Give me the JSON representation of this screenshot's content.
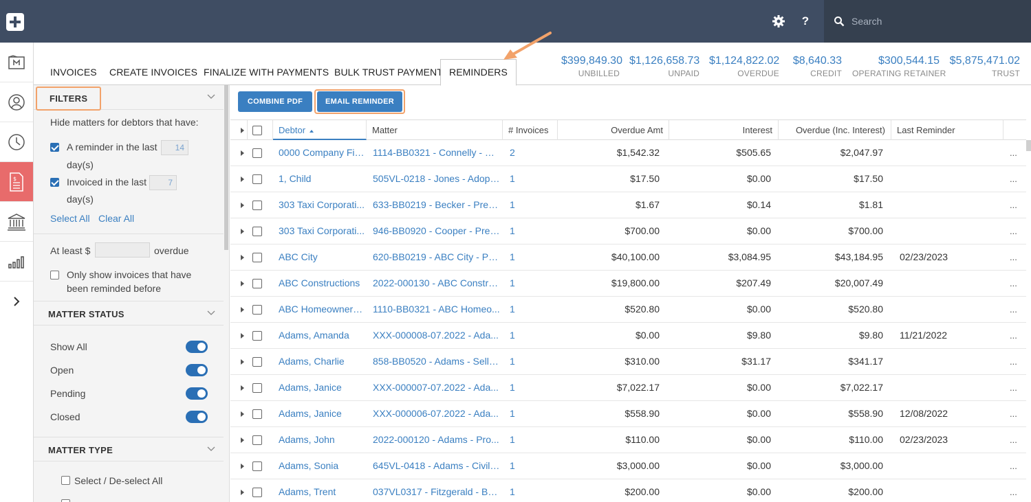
{
  "header": {
    "search_placeholder": "Search",
    "help_label": "?",
    "icons": [
      "add-icon",
      "gear-icon",
      "help-icon",
      "search-icon"
    ]
  },
  "rail": {
    "items": [
      "matters-icon",
      "contacts-icon",
      "time-icon",
      "billing-icon",
      "bank-icon",
      "reports-icon",
      "expand-icon"
    ],
    "active": "billing-icon"
  },
  "tabs": [
    "INVOICES",
    "CREATE INVOICES",
    "FINALIZE WITH PAYMENTS",
    "BULK TRUST PAYMENT",
    "REMINDERS"
  ],
  "active_tab": "REMINDERS",
  "stats": [
    {
      "value": "$399,849.30",
      "label": "UNBILLED"
    },
    {
      "value": "$1,126,658.73",
      "label": "UNPAID"
    },
    {
      "value": "$1,124,822.02",
      "label": "OVERDUE"
    },
    {
      "value": "$8,640.33",
      "label": "CREDIT"
    },
    {
      "value": "$300,544.15",
      "label": "OPERATING RETAINER"
    },
    {
      "value": "$5,875,471.02",
      "label": "TRUST"
    }
  ],
  "filters": {
    "title": "FILTERS",
    "hide_heading": "Hide matters for debtors that have:",
    "reminder_label": "A reminder in the last",
    "reminder_days": "14",
    "reminder_unit": "day(s)",
    "invoiced_label": "Invoiced in the last",
    "invoiced_days": "7",
    "invoiced_unit": "day(s)",
    "select_all": "Select All",
    "clear_all": "Clear All",
    "at_least_label": "At least $",
    "at_least_value": "",
    "overdue_label": "overdue",
    "only_show_line1": "Only show invoices that have",
    "only_show_line2": "been reminded before",
    "matter_status_title": "MATTER STATUS",
    "statuses": [
      "Show All",
      "Open",
      "Pending",
      "Closed"
    ],
    "matter_type_title": "MATTER TYPE",
    "select_deselect_all": "Select / De-select All"
  },
  "toolbar": {
    "combine_pdf": "COMBINE PDF",
    "email_reminder": "EMAIL REMINDER"
  },
  "table": {
    "columns": [
      "Debtor",
      "Matter",
      "# Invoices",
      "Overdue Amt",
      "Interest",
      "Overdue (Inc. Interest)",
      "Last Reminder"
    ],
    "sorted_column": "Debtor",
    "rows": [
      {
        "debtor": "0000 Company Fir...",
        "matter": "1114-BB0321 - Connelly - W...",
        "invoices": "2",
        "overdue": "$1,542.32",
        "interest": "$505.65",
        "total": "$2,047.97",
        "last": ""
      },
      {
        "debtor": "1, Child",
        "matter": "505VL-0218 - Jones - Adopti...",
        "invoices": "1",
        "overdue": "$17.50",
        "interest": "$0.00",
        "total": "$17.50",
        "last": ""
      },
      {
        "debtor": "303 Taxi Corporati...",
        "matter": "633-BB0219 - Becker - Pre D...",
        "invoices": "1",
        "overdue": "$1.67",
        "interest": "$0.14",
        "total": "$1.81",
        "last": ""
      },
      {
        "debtor": "303 Taxi Corporati...",
        "matter": "946-BB0920 - Cooper - Pre ...",
        "invoices": "1",
        "overdue": "$700.00",
        "interest": "$0.00",
        "total": "$700.00",
        "last": ""
      },
      {
        "debtor": "ABC City",
        "matter": "620-BB0219 - ABC City - Pro...",
        "invoices": "1",
        "overdue": "$40,100.00",
        "interest": "$3,084.95",
        "total": "$43,184.95",
        "last": "02/23/2023"
      },
      {
        "debtor": "ABC Constructions",
        "matter": "2022-000130 - ABC Constru...",
        "invoices": "1",
        "overdue": "$19,800.00",
        "interest": "$207.49",
        "total": "$20,007.49",
        "last": ""
      },
      {
        "debtor": "ABC Homeowners...",
        "matter": "1110-BB0321 - ABC Homeo...",
        "invoices": "1",
        "overdue": "$520.80",
        "interest": "$0.00",
        "total": "$520.80",
        "last": ""
      },
      {
        "debtor": "Adams, Amanda",
        "matter": "XXX-000008-07.2022 - Ada...",
        "invoices": "1",
        "overdue": "$0.00",
        "interest": "$9.80",
        "total": "$9.80",
        "last": "11/21/2022"
      },
      {
        "debtor": "Adams, Charlie",
        "matter": "858-BB0520 - Adams - Sell -...",
        "invoices": "1",
        "overdue": "$310.00",
        "interest": "$31.17",
        "total": "$341.17",
        "last": ""
      },
      {
        "debtor": "Adams, Janice",
        "matter": "XXX-000007-07.2022 - Ada...",
        "invoices": "1",
        "overdue": "$7,022.17",
        "interest": "$0.00",
        "total": "$7,022.17",
        "last": ""
      },
      {
        "debtor": "Adams, Janice",
        "matter": "XXX-000006-07.2022 - Ada...",
        "invoices": "1",
        "overdue": "$558.90",
        "interest": "$0.00",
        "total": "$558.90",
        "last": "12/08/2022"
      },
      {
        "debtor": "Adams, John",
        "matter": "2022-000120 - Adams - Pro...",
        "invoices": "1",
        "overdue": "$110.00",
        "interest": "$0.00",
        "total": "$110.00",
        "last": "02/23/2023"
      },
      {
        "debtor": "Adams, Sonia",
        "matter": "645VL-0418 - Adams - Civil ...",
        "invoices": "1",
        "overdue": "$3,000.00",
        "interest": "$0.00",
        "total": "$3,000.00",
        "last": ""
      },
      {
        "debtor": "Adams, Trent",
        "matter": "037VL0317 - Fitzgerald - Bu...",
        "invoices": "1",
        "overdue": "$200.00",
        "interest": "$0.00",
        "total": "$200.00",
        "last": ""
      }
    ],
    "row_menu": "..."
  },
  "colors": {
    "topbar": "#3f4d63",
    "accent": "#3a7fc1",
    "highlight": "#f2a26a",
    "active_rail": "#e86b6b"
  }
}
